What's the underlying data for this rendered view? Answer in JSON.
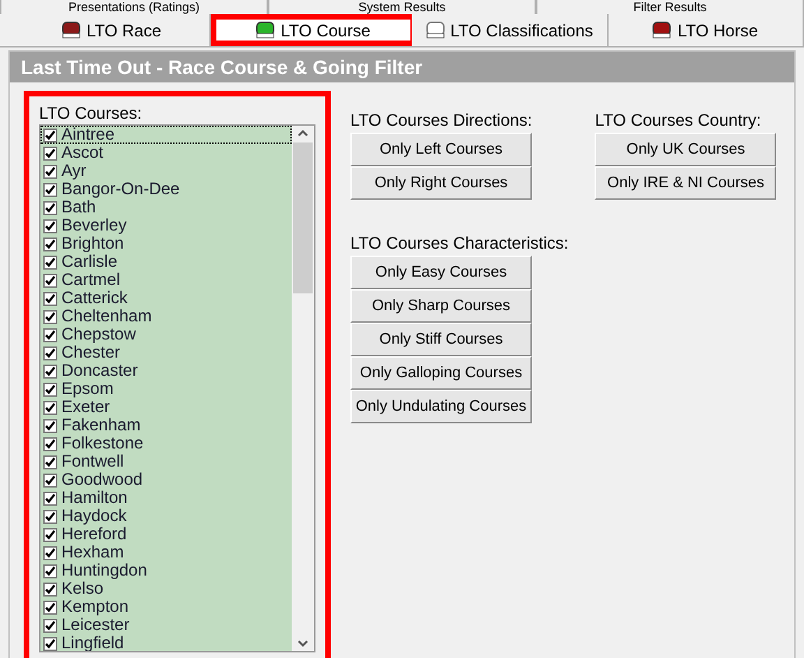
{
  "tabs_row_1": [
    {
      "label": "Presentations (Ratings)",
      "selected": false
    },
    {
      "label": "System Results",
      "selected": false
    },
    {
      "label": "Filter Results",
      "selected": false
    }
  ],
  "tabs_row_2": [
    {
      "label": "LTO Race",
      "selected": false,
      "highlighted": false
    },
    {
      "label": "LTO Course",
      "selected": true,
      "highlighted": true
    },
    {
      "label": "LTO Classifications",
      "selected": false,
      "highlighted": false
    },
    {
      "label": "LTO Horse",
      "selected": false,
      "highlighted": false
    }
  ],
  "panel_title": "Last Time Out - Race Course & Going Filter",
  "courses": {
    "label": "LTO Courses:",
    "highlighted": true,
    "items": [
      {
        "name": "Aintree",
        "checked": true,
        "focused": true
      },
      {
        "name": "Ascot",
        "checked": true,
        "focused": false
      },
      {
        "name": "Ayr",
        "checked": true,
        "focused": false
      },
      {
        "name": "Bangor-On-Dee",
        "checked": true,
        "focused": false
      },
      {
        "name": "Bath",
        "checked": true,
        "focused": false
      },
      {
        "name": "Beverley",
        "checked": true,
        "focused": false
      },
      {
        "name": "Brighton",
        "checked": true,
        "focused": false
      },
      {
        "name": "Carlisle",
        "checked": true,
        "focused": false
      },
      {
        "name": "Cartmel",
        "checked": true,
        "focused": false
      },
      {
        "name": "Catterick",
        "checked": true,
        "focused": false
      },
      {
        "name": "Cheltenham",
        "checked": true,
        "focused": false
      },
      {
        "name": "Chepstow",
        "checked": true,
        "focused": false
      },
      {
        "name": "Chester",
        "checked": true,
        "focused": false
      },
      {
        "name": "Doncaster",
        "checked": true,
        "focused": false
      },
      {
        "name": "Epsom",
        "checked": true,
        "focused": false
      },
      {
        "name": "Exeter",
        "checked": true,
        "focused": false
      },
      {
        "name": "Fakenham",
        "checked": true,
        "focused": false
      },
      {
        "name": "Folkestone",
        "checked": true,
        "focused": false
      },
      {
        "name": "Fontwell",
        "checked": true,
        "focused": false
      },
      {
        "name": "Goodwood",
        "checked": true,
        "focused": false
      },
      {
        "name": "Hamilton",
        "checked": true,
        "focused": false
      },
      {
        "name": "Haydock",
        "checked": true,
        "focused": false
      },
      {
        "name": "Hereford",
        "checked": true,
        "focused": false
      },
      {
        "name": "Hexham",
        "checked": true,
        "focused": false
      },
      {
        "name": "Huntingdon",
        "checked": true,
        "focused": false
      },
      {
        "name": "Kelso",
        "checked": true,
        "focused": false
      },
      {
        "name": "Kempton",
        "checked": true,
        "focused": false
      },
      {
        "name": "Leicester",
        "checked": true,
        "focused": false
      },
      {
        "name": "Lingfield",
        "checked": true,
        "focused": false
      }
    ]
  },
  "directions": {
    "label": "LTO Courses Directions:",
    "buttons": [
      "Only Left Courses",
      "Only Right Courses"
    ]
  },
  "country": {
    "label": "LTO Courses Country:",
    "buttons": [
      "Only UK Courses",
      "Only IRE & NI Courses"
    ]
  },
  "characteristics": {
    "label": "LTO Courses Characteristics:",
    "buttons": [
      "Only Easy Courses",
      "Only Sharp Courses",
      "Only Stiff Courses",
      "Only Galloping Courses",
      "Only Undulating Courses"
    ]
  }
}
